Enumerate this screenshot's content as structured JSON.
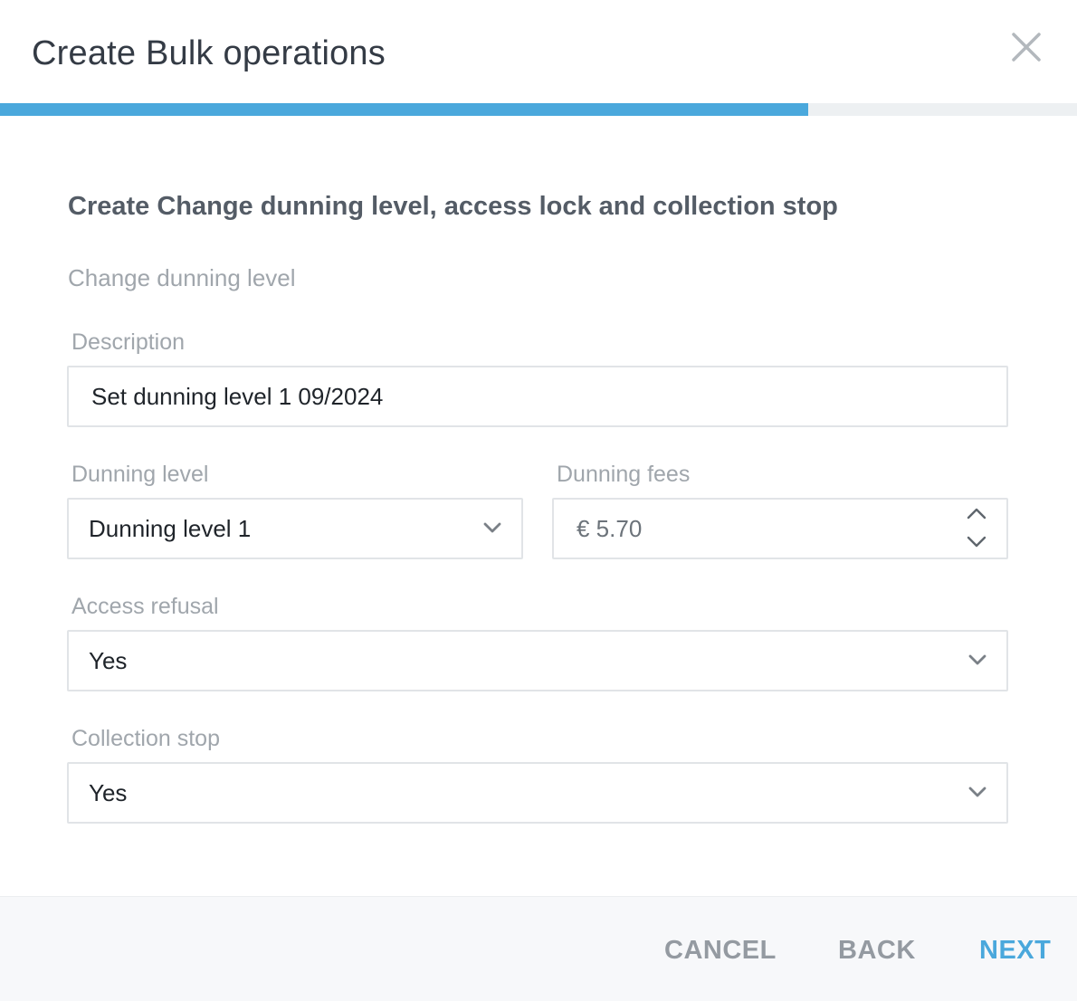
{
  "dialog": {
    "title": "Create Bulk operations",
    "close_icon": "close-icon"
  },
  "progress": {
    "fraction": 0.75,
    "color": "#4aa8dc"
  },
  "form": {
    "section_title": "Create Change dunning level, access lock and collection stop",
    "subsection": "Change dunning level",
    "description": {
      "label": "Description",
      "value": "Set dunning level 1 09/2024"
    },
    "dunning_level": {
      "label": "Dunning level",
      "value": "Dunning level 1",
      "icon": "chevron-down-icon"
    },
    "dunning_fees": {
      "label": "Dunning fees",
      "value": "€ 5.70",
      "icons": [
        "chevron-up-icon",
        "chevron-down-icon"
      ]
    },
    "access_refusal": {
      "label": "Access refusal",
      "value": "Yes",
      "icon": "chevron-down-icon"
    },
    "collection_stop": {
      "label": "Collection stop",
      "value": "Yes",
      "icon": "chevron-down-icon"
    }
  },
  "footer": {
    "cancel_label": "CANCEL",
    "back_label": "BACK",
    "next_label": "NEXT"
  },
  "colors": {
    "accent": "#4aa8dc",
    "muted_button": "#949aa1",
    "label": "#a0a6ac"
  }
}
